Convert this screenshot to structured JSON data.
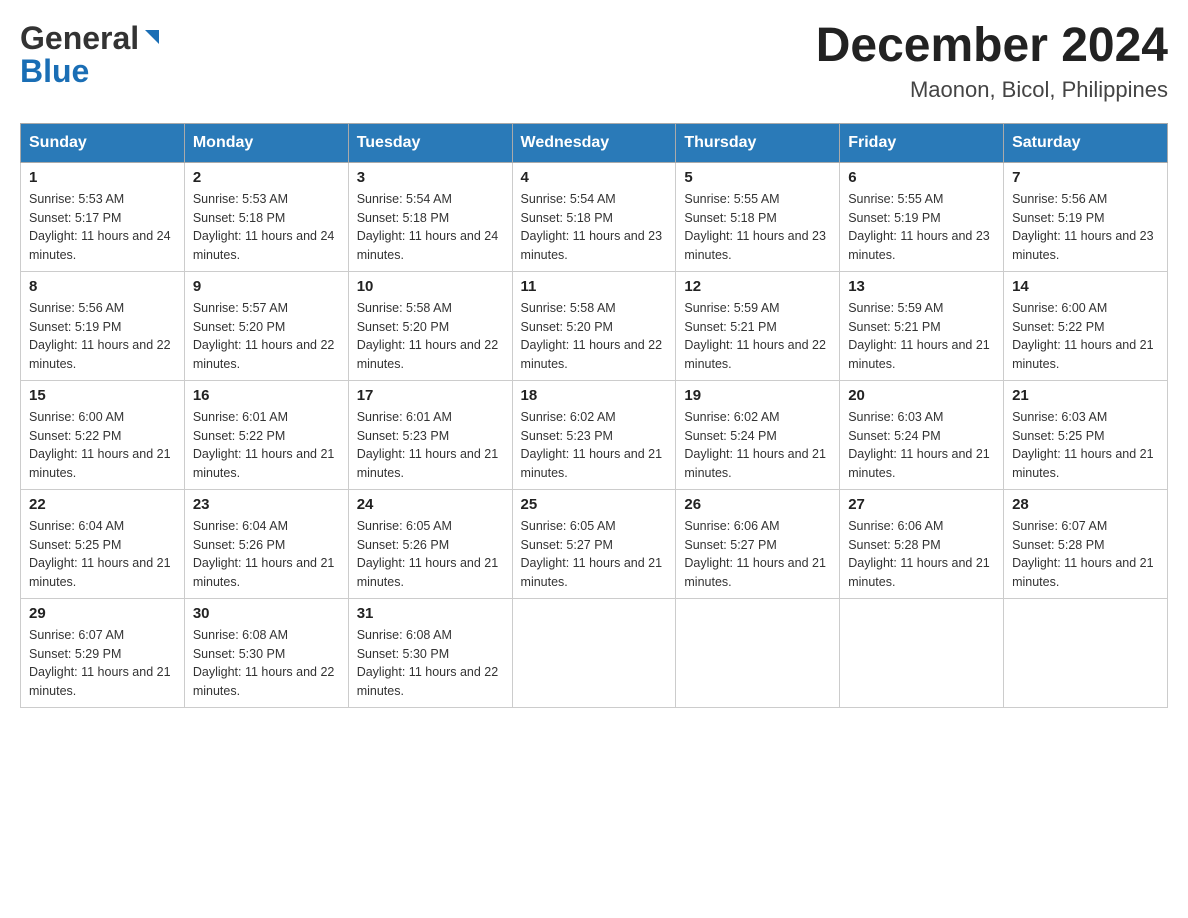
{
  "header": {
    "logo_general": "General",
    "logo_blue": "Blue",
    "month_title": "December 2024",
    "location": "Maonon, Bicol, Philippines"
  },
  "weekdays": [
    "Sunday",
    "Monday",
    "Tuesday",
    "Wednesday",
    "Thursday",
    "Friday",
    "Saturday"
  ],
  "weeks": [
    [
      {
        "day": "1",
        "sunrise": "5:53 AM",
        "sunset": "5:17 PM",
        "daylight": "11 hours and 24 minutes."
      },
      {
        "day": "2",
        "sunrise": "5:53 AM",
        "sunset": "5:18 PM",
        "daylight": "11 hours and 24 minutes."
      },
      {
        "day": "3",
        "sunrise": "5:54 AM",
        "sunset": "5:18 PM",
        "daylight": "11 hours and 24 minutes."
      },
      {
        "day": "4",
        "sunrise": "5:54 AM",
        "sunset": "5:18 PM",
        "daylight": "11 hours and 23 minutes."
      },
      {
        "day": "5",
        "sunrise": "5:55 AM",
        "sunset": "5:18 PM",
        "daylight": "11 hours and 23 minutes."
      },
      {
        "day": "6",
        "sunrise": "5:55 AM",
        "sunset": "5:19 PM",
        "daylight": "11 hours and 23 minutes."
      },
      {
        "day": "7",
        "sunrise": "5:56 AM",
        "sunset": "5:19 PM",
        "daylight": "11 hours and 23 minutes."
      }
    ],
    [
      {
        "day": "8",
        "sunrise": "5:56 AM",
        "sunset": "5:19 PM",
        "daylight": "11 hours and 22 minutes."
      },
      {
        "day": "9",
        "sunrise": "5:57 AM",
        "sunset": "5:20 PM",
        "daylight": "11 hours and 22 minutes."
      },
      {
        "day": "10",
        "sunrise": "5:58 AM",
        "sunset": "5:20 PM",
        "daylight": "11 hours and 22 minutes."
      },
      {
        "day": "11",
        "sunrise": "5:58 AM",
        "sunset": "5:20 PM",
        "daylight": "11 hours and 22 minutes."
      },
      {
        "day": "12",
        "sunrise": "5:59 AM",
        "sunset": "5:21 PM",
        "daylight": "11 hours and 22 minutes."
      },
      {
        "day": "13",
        "sunrise": "5:59 AM",
        "sunset": "5:21 PM",
        "daylight": "11 hours and 21 minutes."
      },
      {
        "day": "14",
        "sunrise": "6:00 AM",
        "sunset": "5:22 PM",
        "daylight": "11 hours and 21 minutes."
      }
    ],
    [
      {
        "day": "15",
        "sunrise": "6:00 AM",
        "sunset": "5:22 PM",
        "daylight": "11 hours and 21 minutes."
      },
      {
        "day": "16",
        "sunrise": "6:01 AM",
        "sunset": "5:22 PM",
        "daylight": "11 hours and 21 minutes."
      },
      {
        "day": "17",
        "sunrise": "6:01 AM",
        "sunset": "5:23 PM",
        "daylight": "11 hours and 21 minutes."
      },
      {
        "day": "18",
        "sunrise": "6:02 AM",
        "sunset": "5:23 PM",
        "daylight": "11 hours and 21 minutes."
      },
      {
        "day": "19",
        "sunrise": "6:02 AM",
        "sunset": "5:24 PM",
        "daylight": "11 hours and 21 minutes."
      },
      {
        "day": "20",
        "sunrise": "6:03 AM",
        "sunset": "5:24 PM",
        "daylight": "11 hours and 21 minutes."
      },
      {
        "day": "21",
        "sunrise": "6:03 AM",
        "sunset": "5:25 PM",
        "daylight": "11 hours and 21 minutes."
      }
    ],
    [
      {
        "day": "22",
        "sunrise": "6:04 AM",
        "sunset": "5:25 PM",
        "daylight": "11 hours and 21 minutes."
      },
      {
        "day": "23",
        "sunrise": "6:04 AM",
        "sunset": "5:26 PM",
        "daylight": "11 hours and 21 minutes."
      },
      {
        "day": "24",
        "sunrise": "6:05 AM",
        "sunset": "5:26 PM",
        "daylight": "11 hours and 21 minutes."
      },
      {
        "day": "25",
        "sunrise": "6:05 AM",
        "sunset": "5:27 PM",
        "daylight": "11 hours and 21 minutes."
      },
      {
        "day": "26",
        "sunrise": "6:06 AM",
        "sunset": "5:27 PM",
        "daylight": "11 hours and 21 minutes."
      },
      {
        "day": "27",
        "sunrise": "6:06 AM",
        "sunset": "5:28 PM",
        "daylight": "11 hours and 21 minutes."
      },
      {
        "day": "28",
        "sunrise": "6:07 AM",
        "sunset": "5:28 PM",
        "daylight": "11 hours and 21 minutes."
      }
    ],
    [
      {
        "day": "29",
        "sunrise": "6:07 AM",
        "sunset": "5:29 PM",
        "daylight": "11 hours and 21 minutes."
      },
      {
        "day": "30",
        "sunrise": "6:08 AM",
        "sunset": "5:30 PM",
        "daylight": "11 hours and 22 minutes."
      },
      {
        "day": "31",
        "sunrise": "6:08 AM",
        "sunset": "5:30 PM",
        "daylight": "11 hours and 22 minutes."
      },
      null,
      null,
      null,
      null
    ]
  ],
  "labels": {
    "sunrise": "Sunrise:",
    "sunset": "Sunset:",
    "daylight": "Daylight:"
  }
}
